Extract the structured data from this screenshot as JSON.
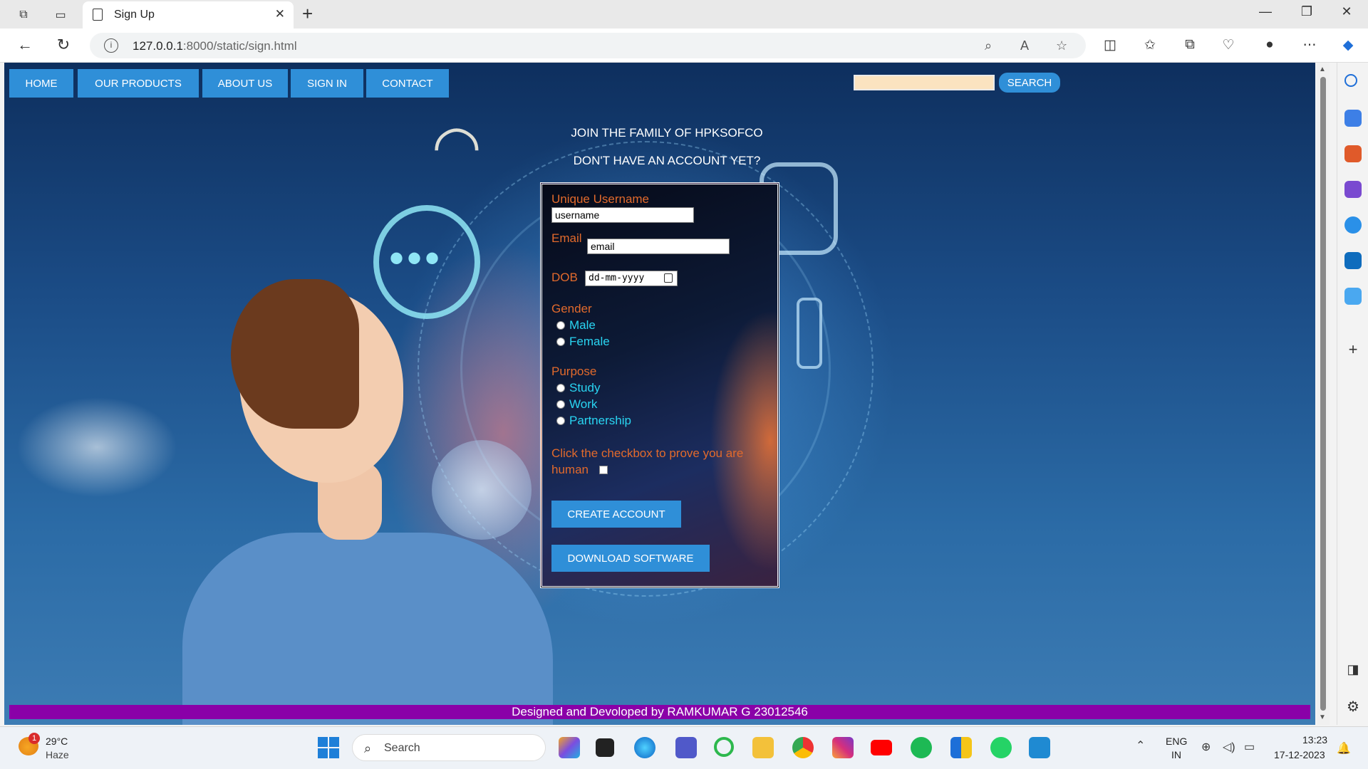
{
  "browser": {
    "tab_title": "Sign Up",
    "url_host": "127.0.0.1",
    "url_path": ":8000/static/sign.html",
    "new_tab_glyph": "+",
    "close_glyph": "✕"
  },
  "page": {
    "nav": [
      "HOME",
      "OUR PRODUCTS",
      "ABOUT US",
      "SIGN IN",
      "CONTACT"
    ],
    "search_button": "SEARCH",
    "search_value": "",
    "headline_1": "JOIN THE FAMILY OF HPKSOFCO",
    "headline_2": "DON'T HAVE AN ACCOUNT YET?",
    "form": {
      "username_label": "Unique Username",
      "username_value": "username",
      "email_label": "Email",
      "email_value": "email",
      "dob_label": "DOB",
      "dob_placeholder": "dd-mm-yyyy",
      "gender_label": "Gender",
      "gender_options": [
        "Male",
        "Female"
      ],
      "purpose_label": "Purpose",
      "purpose_options": [
        "Study",
        "Work",
        "Partnership"
      ],
      "human_label_1": "Click the checkbox to prove you are",
      "human_label_2": "human",
      "create_button": "CREATE ACCOUNT",
      "download_button": "DOWNLOAD SOFTWARE"
    },
    "footer": "Designed and Devoloped by RAMKUMAR G 23012546"
  },
  "taskbar": {
    "weather_temp": "29°C",
    "weather_desc": "Haze",
    "weather_badge": "1",
    "search_label": "Search",
    "lang_1": "ENG",
    "lang_2": "IN",
    "time": "13:23",
    "date": "17-12-2023"
  },
  "colors": {
    "nav_blue": "#2f8fd8",
    "label_orange": "#e26a2c",
    "option_cyan": "#29d5f2",
    "footer_purple": "#8a00a8",
    "search_field": "#fbe3c0"
  }
}
